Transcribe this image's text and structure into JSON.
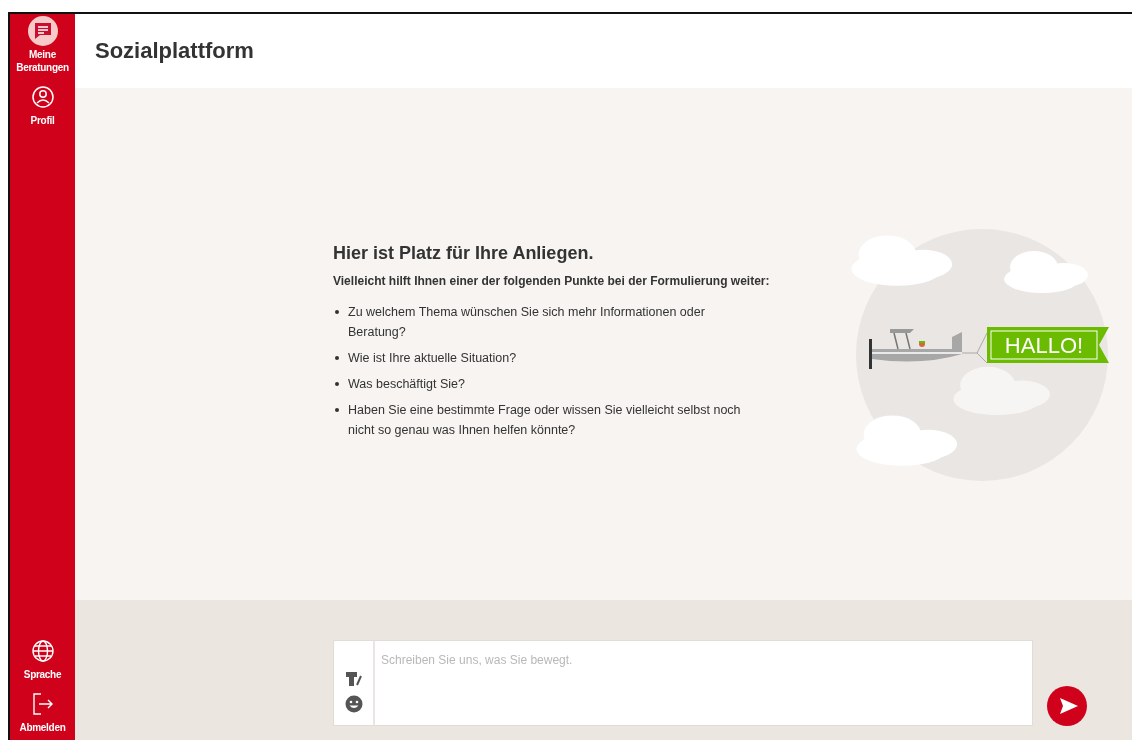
{
  "sidebar": {
    "top_items": [
      {
        "label": "Meine\nBeratungen",
        "selected": true
      },
      {
        "label": "Profil",
        "selected": false
      }
    ],
    "bottom_items": [
      {
        "label": "Sprache",
        "selected": false
      },
      {
        "label": "Abmelden",
        "selected": false
      }
    ]
  },
  "header": {
    "title": "Sozialplattform"
  },
  "intro": {
    "heading": "Hier ist Platz für Ihre Anliegen.",
    "subheading": "Vielleicht hilft Ihnen einer der folgenden Punkte bei der Formulierung weiter:",
    "points": [
      "Zu welchem Thema wünschen Sie sich mehr Informationen oder Beratung?",
      "Wie ist Ihre aktuelle Situation?",
      "Was beschäftigt Sie?",
      "Haben Sie eine bestimmte Frage oder wissen Sie vielleicht selbst noch nicht so genau was Ihnen helfen könnte?"
    ]
  },
  "illustration": {
    "banner": "HALLO!"
  },
  "composer": {
    "placeholder": "Schreiben Sie uns, was Sie bewegt."
  }
}
